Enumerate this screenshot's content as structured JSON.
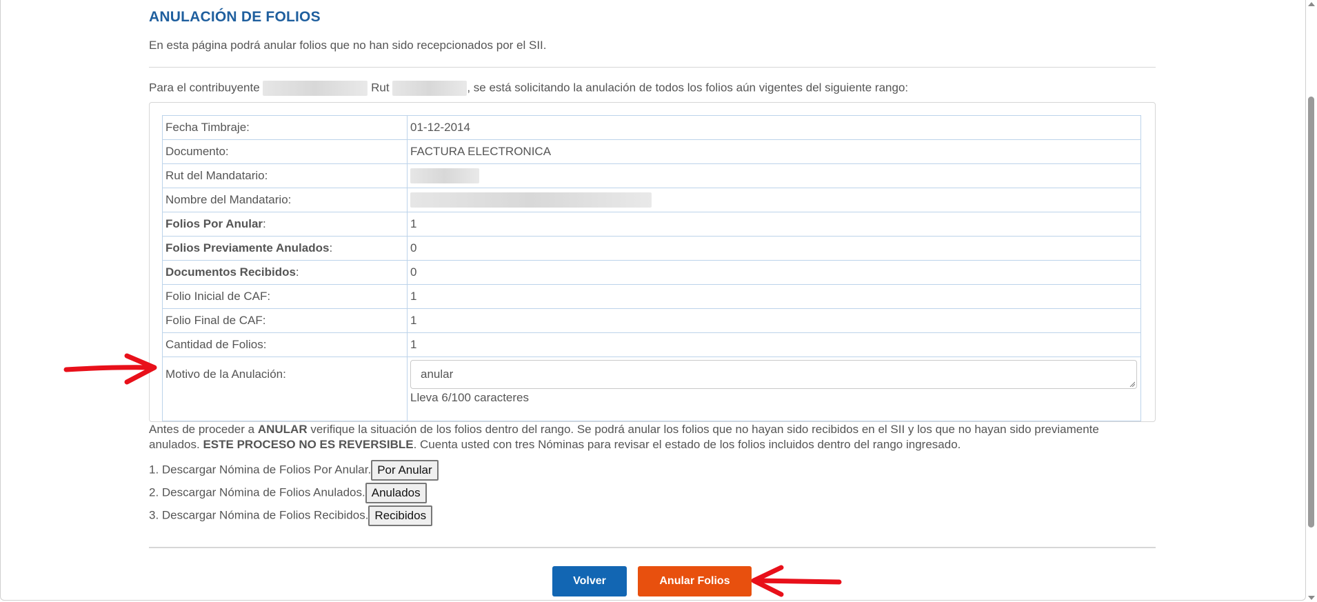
{
  "page": {
    "title": "ANULACIÓN DE FOLIOS",
    "intro": "En esta página podrá anular folios que no han sido recepcionados por el SII."
  },
  "request": {
    "prefix": "Para el contribuyente",
    "rut_label": "Rut",
    "suffix": ", se está solicitando la anulación de todos los folios aún vigentes del siguiente rango:"
  },
  "details": [
    {
      "label": "Fecha Timbraje:",
      "value": "01-12-2014"
    },
    {
      "label": "Documento:",
      "value": "FACTURA ELECTRONICA"
    },
    {
      "label": "Rut del Mandatario:",
      "value": ""
    },
    {
      "label": "Nombre del Mandatario:",
      "value": ""
    },
    {
      "label": "Folios Por Anular",
      "value": "1"
    },
    {
      "label": "Folios Previamente Anulados",
      "value": "0"
    },
    {
      "label": "Documentos Recibidos",
      "value": "0"
    },
    {
      "label": "Folio Inicial de CAF:",
      "value": "1"
    },
    {
      "label": "Folio Final de CAF:",
      "value": "1"
    },
    {
      "label": "Cantidad de Folios:",
      "value": "1"
    }
  ],
  "motivo": {
    "label": "Motivo de la Anulación:",
    "value": "anular",
    "char_count": "Lleva 6/100 caracteres"
  },
  "warning": {
    "part1": "Antes de proceder a ",
    "bold1": "ANULAR",
    "part2": " verifique la situación de los folios dentro del rango. Se podrá anular los folios que no hayan sido recibidos en el SII y los que no hayan sido previamente anulados. ",
    "bold2": "ESTE PROCESO NO ES REVERSIBLE",
    "part3": ". Cuenta usted con tres Nóminas para revisar el estado de los folios incluidos dentro del rango ingresado."
  },
  "downloads": [
    {
      "text": "1. Descargar Nómina de Folios Por Anular.",
      "button": "Por Anular"
    },
    {
      "text": "2. Descargar Nómina de Folios Anulados.",
      "button": "Anulados"
    },
    {
      "text": "3. Descargar Nómina de Folios Recibidos.",
      "button": "Recibidos"
    }
  ],
  "actions": {
    "back": "Volver",
    "submit": "Anular Folios"
  },
  "colors": {
    "title": "#1f5f9e",
    "primary_button": "#1266b3",
    "danger_button": "#e8500e",
    "annotation_arrow": "#e8101a"
  }
}
